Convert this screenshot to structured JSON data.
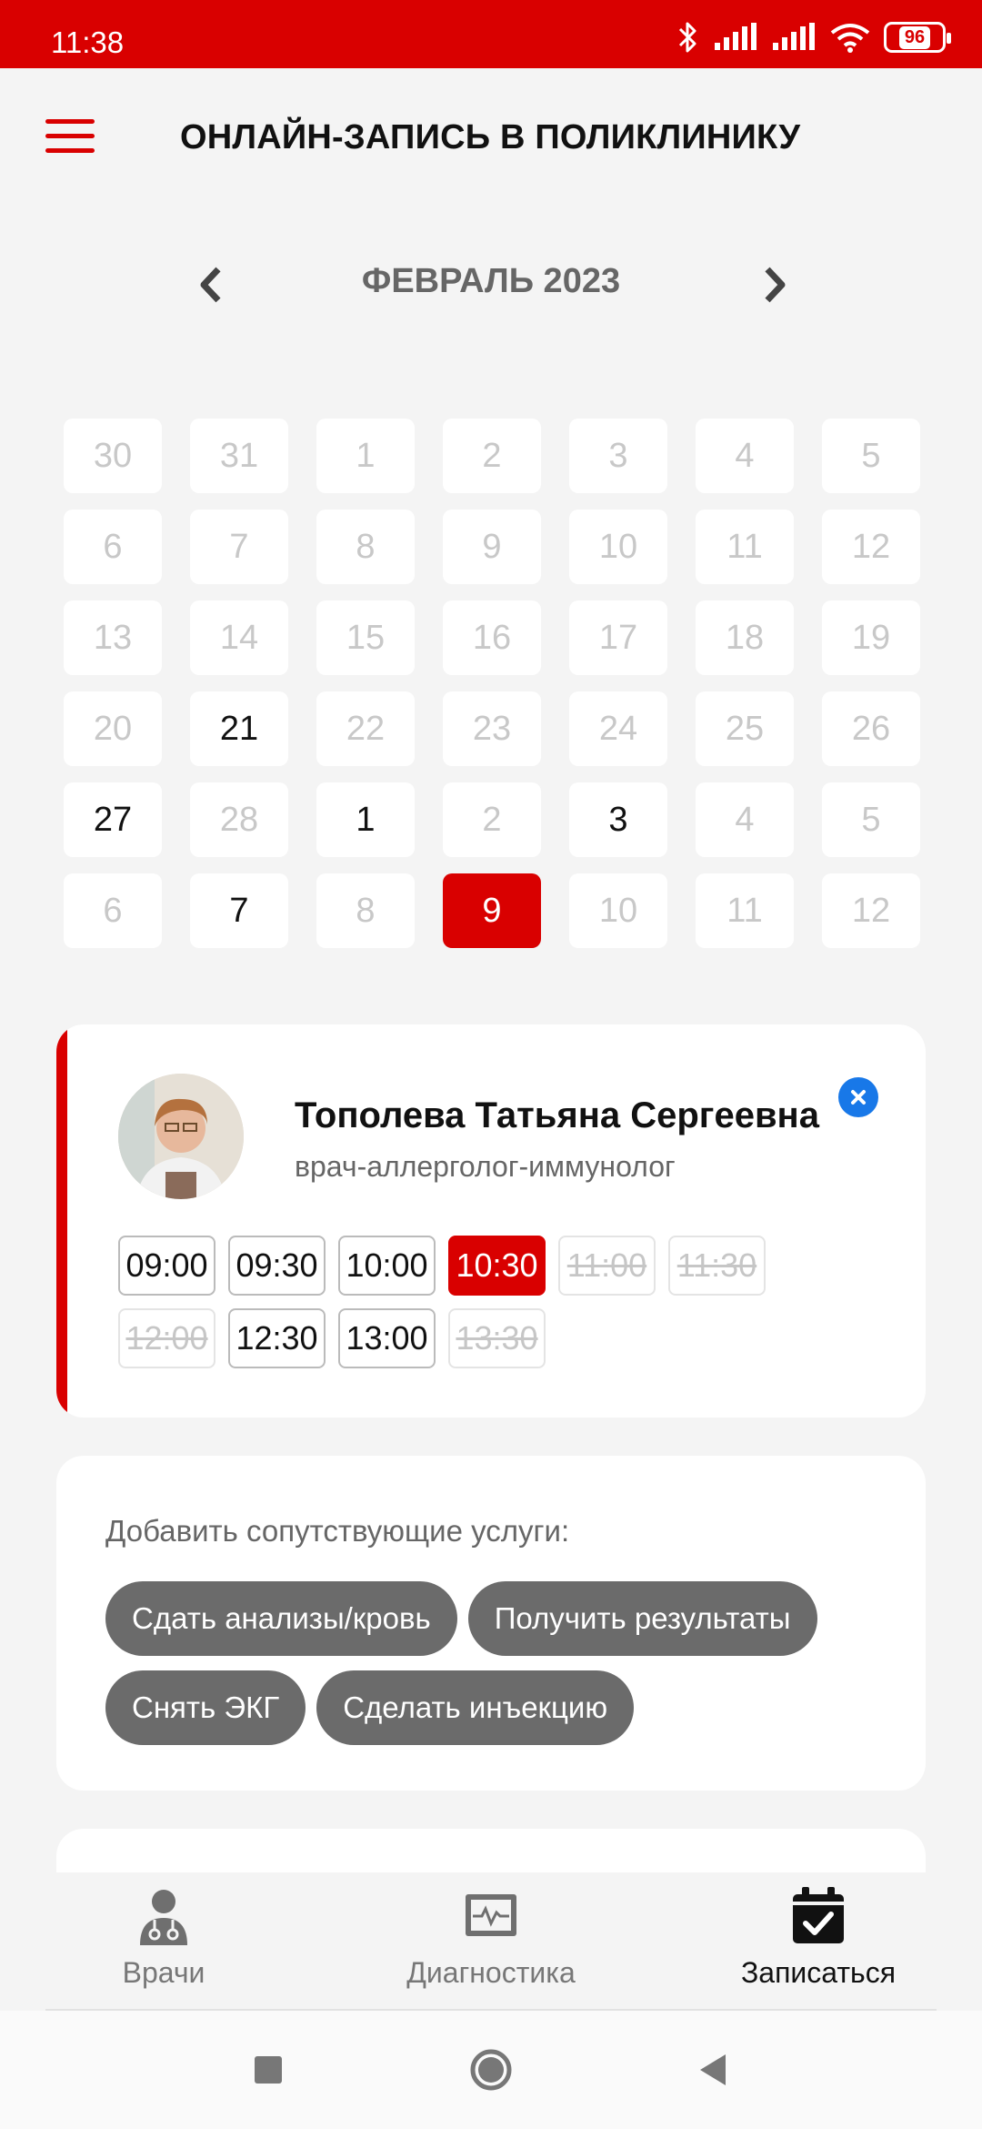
{
  "status_bar": {
    "time": "11:38",
    "battery": "96"
  },
  "header": {
    "title": "ОНЛАЙН-ЗАПИСЬ В ПОЛИКЛИНИКУ"
  },
  "calendar": {
    "month_label": "ФЕВРАЛЬ 2023",
    "days": [
      {
        "label": "30",
        "state": "disabled"
      },
      {
        "label": "31",
        "state": "disabled"
      },
      {
        "label": "1",
        "state": "disabled"
      },
      {
        "label": "2",
        "state": "disabled"
      },
      {
        "label": "3",
        "state": "disabled"
      },
      {
        "label": "4",
        "state": "disabled"
      },
      {
        "label": "5",
        "state": "disabled"
      },
      {
        "label": "6",
        "state": "disabled"
      },
      {
        "label": "7",
        "state": "disabled"
      },
      {
        "label": "8",
        "state": "disabled"
      },
      {
        "label": "9",
        "state": "disabled"
      },
      {
        "label": "10",
        "state": "disabled"
      },
      {
        "label": "11",
        "state": "disabled"
      },
      {
        "label": "12",
        "state": "disabled"
      },
      {
        "label": "13",
        "state": "disabled"
      },
      {
        "label": "14",
        "state": "disabled"
      },
      {
        "label": "15",
        "state": "disabled"
      },
      {
        "label": "16",
        "state": "disabled"
      },
      {
        "label": "17",
        "state": "disabled"
      },
      {
        "label": "18",
        "state": "disabled"
      },
      {
        "label": "19",
        "state": "disabled"
      },
      {
        "label": "20",
        "state": "disabled"
      },
      {
        "label": "21",
        "state": "available"
      },
      {
        "label": "22",
        "state": "disabled"
      },
      {
        "label": "23",
        "state": "disabled"
      },
      {
        "label": "24",
        "state": "disabled"
      },
      {
        "label": "25",
        "state": "disabled"
      },
      {
        "label": "26",
        "state": "disabled"
      },
      {
        "label": "27",
        "state": "available"
      },
      {
        "label": "28",
        "state": "disabled"
      },
      {
        "label": "1",
        "state": "available"
      },
      {
        "label": "2",
        "state": "disabled"
      },
      {
        "label": "3",
        "state": "available"
      },
      {
        "label": "4",
        "state": "disabled"
      },
      {
        "label": "5",
        "state": "disabled"
      },
      {
        "label": "6",
        "state": "disabled"
      },
      {
        "label": "7",
        "state": "available"
      },
      {
        "label": "8",
        "state": "disabled"
      },
      {
        "label": "9",
        "state": "selected"
      },
      {
        "label": "10",
        "state": "disabled"
      },
      {
        "label": "11",
        "state": "disabled"
      },
      {
        "label": "12",
        "state": "disabled"
      }
    ]
  },
  "doctor": {
    "name": "Тополева Татьяна Сергеевна",
    "specialty": "врач-аллерголог-иммунолог",
    "slots": [
      {
        "time": "09:00",
        "state": "available"
      },
      {
        "time": "09:30",
        "state": "available"
      },
      {
        "time": "10:00",
        "state": "available"
      },
      {
        "time": "10:30",
        "state": "selected"
      },
      {
        "time": "11:00",
        "state": "unavailable"
      },
      {
        "time": "11:30",
        "state": "unavailable"
      },
      {
        "time": "12:00",
        "state": "unavailable"
      },
      {
        "time": "12:30",
        "state": "available"
      },
      {
        "time": "13:00",
        "state": "available"
      },
      {
        "time": "13:30",
        "state": "unavailable"
      }
    ]
  },
  "services": {
    "label": "Добавить сопутствующие услуги:",
    "chips": [
      "Сдать анализы/кровь",
      "Получить результаты",
      "Снять ЭКГ",
      "Сделать инъекцию"
    ]
  },
  "tabs": [
    {
      "label": "Врачи",
      "icon": "doctor-icon",
      "active": false
    },
    {
      "label": "Диагностика",
      "icon": "monitor-icon",
      "active": false
    },
    {
      "label": "Записаться",
      "icon": "calendar-check-icon",
      "active": true
    }
  ],
  "colors": {
    "accent": "#d90000",
    "close_button": "#1878e8",
    "chip": "#6b6b6b",
    "disabled_text": "#c8c8c8"
  }
}
